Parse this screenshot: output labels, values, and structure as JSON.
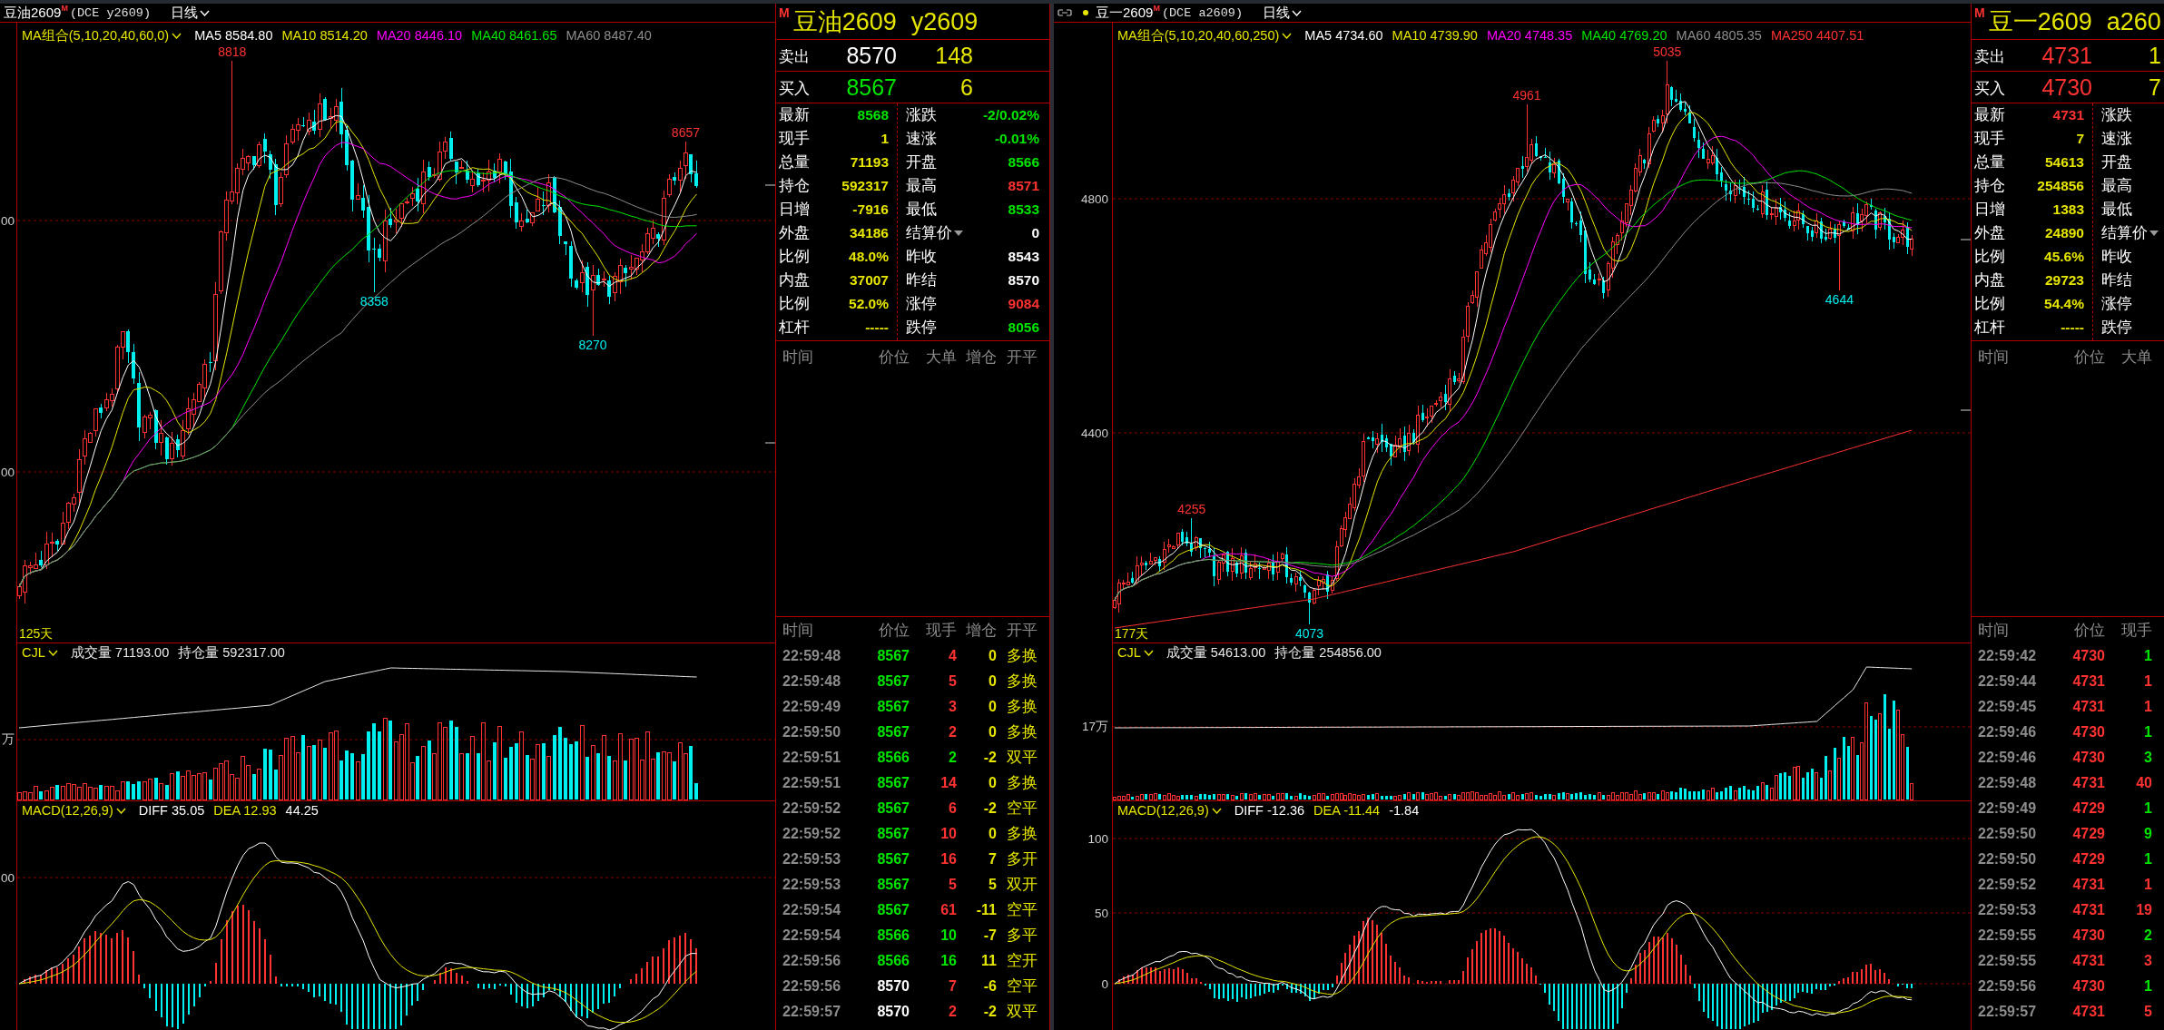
{
  "windows": [
    {
      "header": {
        "title": "豆油2609$^{M}$",
        "exchange": "(DCE y2609)",
        "period": "日线",
        "linked": false
      },
      "price_chart": {
        "indicator": "MA组合(5,10,20,40,60,0)",
        "lines": [
          {
            "label": "MA5 8584.80",
            "color": "#ffffff"
          },
          {
            "label": "MA10 8514.20",
            "color": "#e6e600"
          },
          {
            "label": "MA20 8446.10",
            "color": "#ff00ff"
          },
          {
            "label": "MA40 8461.65",
            "color": "#00e600"
          },
          {
            "label": "MA60 8487.40",
            "color": "#8c8c8c"
          }
        ],
        "ticks": [
          "00",
          "00"
        ],
        "marks": [
          {
            "text": "8818",
            "kind": "high"
          },
          {
            "text": "8358",
            "kind": "low"
          },
          {
            "text": "8270",
            "kind": "low"
          },
          {
            "text": "8657",
            "kind": "high"
          }
        ],
        "days": "125天"
      },
      "volume_chart": {
        "indicator": "CJL",
        "stats": [
          "成交量 71193.00",
          "持仓量 592317.00"
        ],
        "ticks": [
          "万"
        ]
      },
      "macd_chart": {
        "indicator": "MACD(12,26,9)",
        "stats": [
          {
            "label": "DIFF 35.05",
            "color": "#ffffff"
          },
          {
            "label": "DEA 12.93",
            "color": "#e6e600"
          },
          {
            "label": "44.25",
            "color": "#ffffff"
          }
        ],
        "ticks": [
          "00"
        ]
      },
      "quote": {
        "flag": "M",
        "name": "豆油2609",
        "code": "y2609",
        "ask": {
          "label": "卖出",
          "price": {
            "text": "8570",
            "color": "#ffffff"
          },
          "volume": "148"
        },
        "bid": {
          "label": "买入",
          "price": {
            "text": "8567",
            "color": "#00e600"
          },
          "volume": "6"
        },
        "stats_left": [
          {
            "label": "最新",
            "value": "8568",
            "color": "#00e600"
          },
          {
            "label": "现手",
            "value": "1",
            "color": "#e6e600"
          },
          {
            "label": "总量",
            "value": "71193",
            "color": "#e6e600"
          },
          {
            "label": "持仓",
            "value": "592317",
            "color": "#e6e600"
          },
          {
            "label": "日增",
            "value": "-7916",
            "color": "#e6e600"
          },
          {
            "label": "外盘",
            "value": "34186",
            "color": "#e6e600"
          },
          {
            "label": "比例",
            "value": "48.0%",
            "color": "#e6e600"
          },
          {
            "label": "内盘",
            "value": "37007",
            "color": "#e6e600"
          },
          {
            "label": "比例",
            "value": "52.0%",
            "color": "#e6e600"
          },
          {
            "label": "杠杆",
            "value": "-----",
            "color": "#e6e600"
          }
        ],
        "stats_right": [
          {
            "label": "涨跌",
            "value": "-2/0.02%",
            "color": "#00e600",
            "dropdown": false
          },
          {
            "label": "速涨",
            "value": "-0.01%",
            "color": "#00e600",
            "dropdown": false
          },
          {
            "label": "开盘",
            "value": "8566",
            "color": "#00e600",
            "dropdown": false
          },
          {
            "label": "最高",
            "value": "8571",
            "color": "#ff3232",
            "dropdown": false
          },
          {
            "label": "最低",
            "value": "8533",
            "color": "#00e600",
            "dropdown": false
          },
          {
            "label": "结算价",
            "value": "0",
            "color": "#ffffff",
            "dropdown": true
          },
          {
            "label": "昨收",
            "value": "8543",
            "color": "#ffffff",
            "dropdown": false
          },
          {
            "label": "昨结",
            "value": "8570",
            "color": "#ffffff",
            "dropdown": false
          },
          {
            "label": "涨停",
            "value": "9084",
            "color": "#ff3232",
            "dropdown": false
          },
          {
            "label": "跌停",
            "value": "8056",
            "color": "#00e600",
            "dropdown": false
          }
        ],
        "big_orders": {
          "columns": [
            "时间",
            "价位",
            "大单",
            "增仓",
            "开平"
          ]
        },
        "trades": {
          "columns": [
            "时间",
            "价位",
            "现手",
            "增仓",
            "开平"
          ],
          "rows": [
            {
              "time": "22:59:48",
              "price": {
                "text": "8567",
                "color": "#00e600"
              },
              "hand": {
                "text": "4",
                "color": "#ff3232"
              },
              "change": "0",
              "type": "多换"
            },
            {
              "time": "22:59:48",
              "price": {
                "text": "8567",
                "color": "#00e600"
              },
              "hand": {
                "text": "5",
                "color": "#ff3232"
              },
              "change": "0",
              "type": "多换"
            },
            {
              "time": "22:59:49",
              "price": {
                "text": "8567",
                "color": "#00e600"
              },
              "hand": {
                "text": "3",
                "color": "#ff3232"
              },
              "change": "0",
              "type": "多换"
            },
            {
              "time": "22:59:50",
              "price": {
                "text": "8567",
                "color": "#00e600"
              },
              "hand": {
                "text": "2",
                "color": "#ff3232"
              },
              "change": "0",
              "type": "多换"
            },
            {
              "time": "22:59:51",
              "price": {
                "text": "8566",
                "color": "#00e600"
              },
              "hand": {
                "text": "2",
                "color": "#00e600"
              },
              "change": "-2",
              "type": "双平"
            },
            {
              "time": "22:59:51",
              "price": {
                "text": "8567",
                "color": "#00e600"
              },
              "hand": {
                "text": "14",
                "color": "#ff3232"
              },
              "change": "0",
              "type": "多换"
            },
            {
              "time": "22:59:52",
              "price": {
                "text": "8567",
                "color": "#00e600"
              },
              "hand": {
                "text": "6",
                "color": "#ff3232"
              },
              "change": "-2",
              "type": "空平"
            },
            {
              "time": "22:59:52",
              "price": {
                "text": "8567",
                "color": "#00e600"
              },
              "hand": {
                "text": "10",
                "color": "#ff3232"
              },
              "change": "0",
              "type": "多换"
            },
            {
              "time": "22:59:53",
              "price": {
                "text": "8567",
                "color": "#00e600"
              },
              "hand": {
                "text": "16",
                "color": "#ff3232"
              },
              "change": "7",
              "type": "多开"
            },
            {
              "time": "22:59:53",
              "price": {
                "text": "8567",
                "color": "#00e600"
              },
              "hand": {
                "text": "5",
                "color": "#ff3232"
              },
              "change": "5",
              "type": "双开"
            },
            {
              "time": "22:59:54",
              "price": {
                "text": "8567",
                "color": "#00e600"
              },
              "hand": {
                "text": "61",
                "color": "#ff3232"
              },
              "change": "-11",
              "type": "空平"
            },
            {
              "time": "22:59:54",
              "price": {
                "text": "8566",
                "color": "#00e600"
              },
              "hand": {
                "text": "10",
                "color": "#00e600"
              },
              "change": "-7",
              "type": "多平"
            },
            {
              "time": "22:59:56",
              "price": {
                "text": "8566",
                "color": "#00e600"
              },
              "hand": {
                "text": "16",
                "color": "#00e600"
              },
              "change": "11",
              "type": "空开"
            },
            {
              "time": "22:59:56",
              "price": {
                "text": "8570",
                "color": "#ffffff"
              },
              "hand": {
                "text": "7",
                "color": "#ff3232"
              },
              "change": "-6",
              "type": "空平"
            },
            {
              "time": "22:59:57",
              "price": {
                "text": "8570",
                "color": "#ffffff"
              },
              "hand": {
                "text": "2",
                "color": "#ff3232"
              },
              "change": "-2",
              "type": "双平"
            }
          ]
        }
      }
    },
    {
      "header": {
        "title": "豆一2609$^{M}$",
        "exchange": "(DCE a2609)",
        "period": "日线",
        "linked": true
      },
      "price_chart": {
        "indicator": "MA组合(5,10,20,40,60,250)",
        "lines": [
          {
            "label": "MA5 4734.60",
            "color": "#ffffff"
          },
          {
            "label": "MA10 4739.90",
            "color": "#e6e600"
          },
          {
            "label": "MA20 4748.35",
            "color": "#ff00ff"
          },
          {
            "label": "MA40 4769.20",
            "color": "#00e600"
          },
          {
            "label": "MA60 4805.35",
            "color": "#8c8c8c"
          },
          {
            "label": "MA250 4407.51",
            "color": "#ff3232"
          }
        ],
        "ticks": [
          "4800",
          "4400"
        ],
        "marks": [
          {
            "text": "4255",
            "kind": "high"
          },
          {
            "text": "4073",
            "kind": "low"
          },
          {
            "text": "4961",
            "kind": "high"
          },
          {
            "text": "5035",
            "kind": "high"
          },
          {
            "text": "4644",
            "kind": "low"
          }
        ],
        "days": "177天"
      },
      "volume_chart": {
        "indicator": "CJL",
        "stats": [
          "成交量 54613.00",
          "持仓量 254856.00"
        ],
        "ticks": [
          "17万"
        ]
      },
      "macd_chart": {
        "indicator": "MACD(12,26,9)",
        "stats": [
          {
            "label": "DIFF -12.36",
            "color": "#ffffff"
          },
          {
            "label": "DEA -11.44",
            "color": "#e6e600"
          },
          {
            "label": "-1.84",
            "color": "#ffffff"
          }
        ],
        "ticks": [
          "100",
          "50",
          "0"
        ]
      },
      "quote": {
        "flag": "M",
        "name": "豆一2609",
        "code": "a260",
        "ask": {
          "label": "卖出",
          "price": {
            "text": "4731",
            "color": "#ff3232"
          },
          "volume": "1"
        },
        "bid": {
          "label": "买入",
          "price": {
            "text": "4730",
            "color": "#ff3232"
          },
          "volume": "7"
        },
        "stats_left": [
          {
            "label": "最新",
            "value": "4731",
            "color": "#ff3232"
          },
          {
            "label": "现手",
            "value": "7",
            "color": "#e6e600"
          },
          {
            "label": "总量",
            "value": "54613",
            "color": "#e6e600"
          },
          {
            "label": "持仓",
            "value": "254856",
            "color": "#e6e600"
          },
          {
            "label": "日增",
            "value": "1383",
            "color": "#e6e600"
          },
          {
            "label": "外盘",
            "value": "24890",
            "color": "#e6e600"
          },
          {
            "label": "比例",
            "value": "45.6%",
            "color": "#e6e600"
          },
          {
            "label": "内盘",
            "value": "29723",
            "color": "#e6e600"
          },
          {
            "label": "比例",
            "value": "54.4%",
            "color": "#e6e600"
          },
          {
            "label": "杠杆",
            "value": "-----",
            "color": "#e6e600"
          }
        ],
        "stats_right": [
          {
            "label": "涨跌",
            "dropdown": false
          },
          {
            "label": "速涨",
            "dropdown": false
          },
          {
            "label": "开盘",
            "dropdown": false
          },
          {
            "label": "最高",
            "dropdown": false
          },
          {
            "label": "最低",
            "dropdown": false
          },
          {
            "label": "结算价",
            "dropdown": true
          },
          {
            "label": "昨收",
            "dropdown": false
          },
          {
            "label": "昨结",
            "dropdown": false
          },
          {
            "label": "涨停",
            "dropdown": false
          },
          {
            "label": "跌停",
            "dropdown": false
          }
        ],
        "big_orders": {
          "columns": [
            "时间",
            "价位",
            "大单"
          ]
        },
        "trades": {
          "columns": [
            "时间",
            "价位",
            "现手"
          ],
          "rows": [
            {
              "time": "22:59:42",
              "price": {
                "text": "4730",
                "color": "#ff3232"
              },
              "hand": {
                "text": "1",
                "color": "#00e600"
              }
            },
            {
              "time": "22:59:44",
              "price": {
                "text": "4731",
                "color": "#ff3232"
              },
              "hand": {
                "text": "1",
                "color": "#ff3232"
              }
            },
            {
              "time": "22:59:45",
              "price": {
                "text": "4731",
                "color": "#ff3232"
              },
              "hand": {
                "text": "1",
                "color": "#ff3232"
              }
            },
            {
              "time": "22:59:46",
              "price": {
                "text": "4730",
                "color": "#ff3232"
              },
              "hand": {
                "text": "1",
                "color": "#00e600"
              }
            },
            {
              "time": "22:59:46",
              "price": {
                "text": "4730",
                "color": "#ff3232"
              },
              "hand": {
                "text": "3",
                "color": "#00e600"
              }
            },
            {
              "time": "22:59:48",
              "price": {
                "text": "4731",
                "color": "#ff3232"
              },
              "hand": {
                "text": "40",
                "color": "#ff3232"
              }
            },
            {
              "time": "22:59:49",
              "price": {
                "text": "4729",
                "color": "#ff3232"
              },
              "hand": {
                "text": "1",
                "color": "#00e600"
              }
            },
            {
              "time": "22:59:50",
              "price": {
                "text": "4729",
                "color": "#ff3232"
              },
              "hand": {
                "text": "9",
                "color": "#00e600"
              }
            },
            {
              "time": "22:59:50",
              "price": {
                "text": "4729",
                "color": "#ff3232"
              },
              "hand": {
                "text": "1",
                "color": "#00e600"
              }
            },
            {
              "time": "22:59:52",
              "price": {
                "text": "4731",
                "color": "#ff3232"
              },
              "hand": {
                "text": "1",
                "color": "#ff3232"
              }
            },
            {
              "time": "22:59:53",
              "price": {
                "text": "4731",
                "color": "#ff3232"
              },
              "hand": {
                "text": "19",
                "color": "#ff3232"
              }
            },
            {
              "time": "22:59:55",
              "price": {
                "text": "4730",
                "color": "#ff3232"
              },
              "hand": {
                "text": "2",
                "color": "#00e600"
              }
            },
            {
              "time": "22:59:55",
              "price": {
                "text": "4731",
                "color": "#ff3232"
              },
              "hand": {
                "text": "3",
                "color": "#ff3232"
              }
            },
            {
              "time": "22:59:56",
              "price": {
                "text": "4730",
                "color": "#ff3232"
              },
              "hand": {
                "text": "1",
                "color": "#00e600"
              }
            },
            {
              "time": "22:59:57",
              "price": {
                "text": "4731",
                "color": "#ff3232"
              },
              "hand": {
                "text": "5",
                "color": "#ff3232"
              }
            }
          ]
        }
      }
    }
  ]
}
